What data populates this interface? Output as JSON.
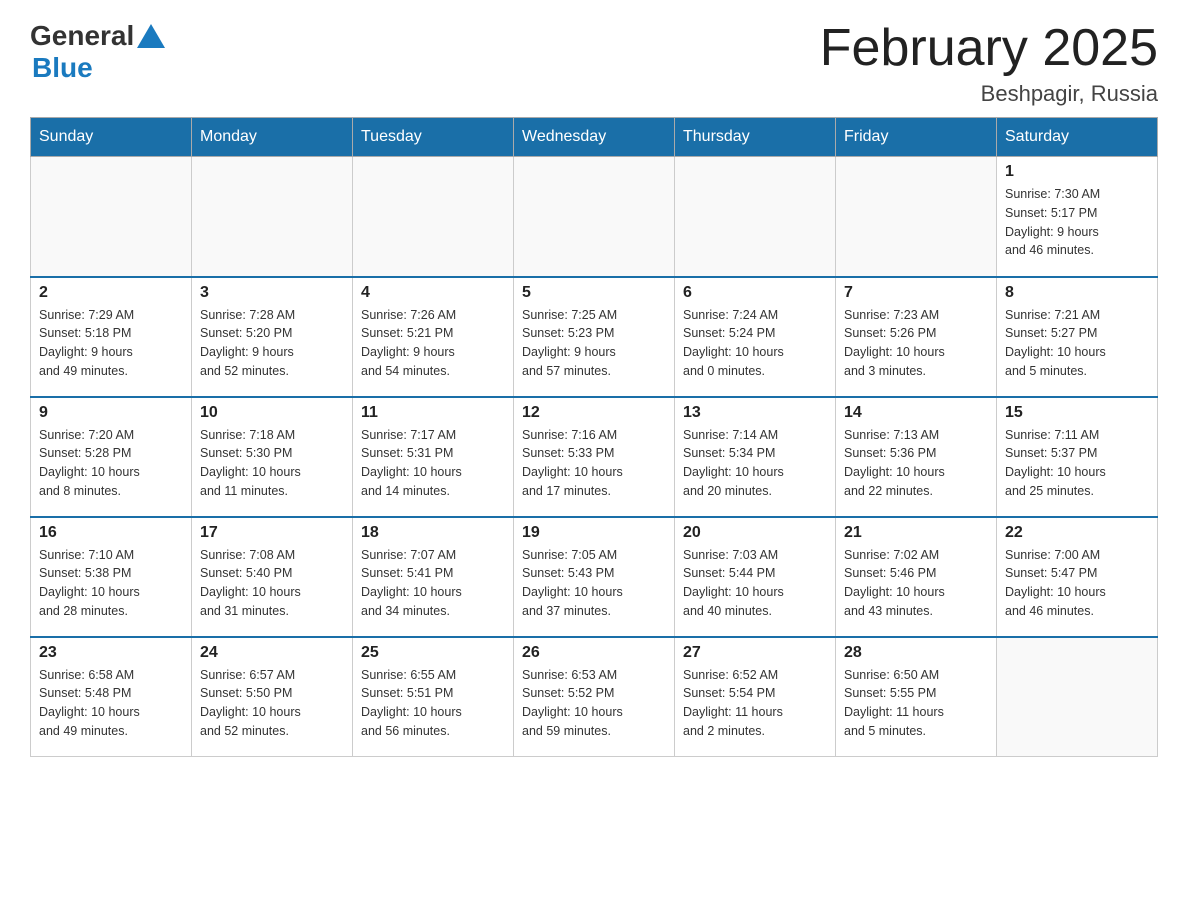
{
  "logo": {
    "general": "General",
    "blue": "Blue"
  },
  "title": "February 2025",
  "location": "Beshpagir, Russia",
  "days_of_week": [
    "Sunday",
    "Monday",
    "Tuesday",
    "Wednesday",
    "Thursday",
    "Friday",
    "Saturday"
  ],
  "weeks": [
    [
      {
        "day": "",
        "info": ""
      },
      {
        "day": "",
        "info": ""
      },
      {
        "day": "",
        "info": ""
      },
      {
        "day": "",
        "info": ""
      },
      {
        "day": "",
        "info": ""
      },
      {
        "day": "",
        "info": ""
      },
      {
        "day": "1",
        "info": "Sunrise: 7:30 AM\nSunset: 5:17 PM\nDaylight: 9 hours\nand 46 minutes."
      }
    ],
    [
      {
        "day": "2",
        "info": "Sunrise: 7:29 AM\nSunset: 5:18 PM\nDaylight: 9 hours\nand 49 minutes."
      },
      {
        "day": "3",
        "info": "Sunrise: 7:28 AM\nSunset: 5:20 PM\nDaylight: 9 hours\nand 52 minutes."
      },
      {
        "day": "4",
        "info": "Sunrise: 7:26 AM\nSunset: 5:21 PM\nDaylight: 9 hours\nand 54 minutes."
      },
      {
        "day": "5",
        "info": "Sunrise: 7:25 AM\nSunset: 5:23 PM\nDaylight: 9 hours\nand 57 minutes."
      },
      {
        "day": "6",
        "info": "Sunrise: 7:24 AM\nSunset: 5:24 PM\nDaylight: 10 hours\nand 0 minutes."
      },
      {
        "day": "7",
        "info": "Sunrise: 7:23 AM\nSunset: 5:26 PM\nDaylight: 10 hours\nand 3 minutes."
      },
      {
        "day": "8",
        "info": "Sunrise: 7:21 AM\nSunset: 5:27 PM\nDaylight: 10 hours\nand 5 minutes."
      }
    ],
    [
      {
        "day": "9",
        "info": "Sunrise: 7:20 AM\nSunset: 5:28 PM\nDaylight: 10 hours\nand 8 minutes."
      },
      {
        "day": "10",
        "info": "Sunrise: 7:18 AM\nSunset: 5:30 PM\nDaylight: 10 hours\nand 11 minutes."
      },
      {
        "day": "11",
        "info": "Sunrise: 7:17 AM\nSunset: 5:31 PM\nDaylight: 10 hours\nand 14 minutes."
      },
      {
        "day": "12",
        "info": "Sunrise: 7:16 AM\nSunset: 5:33 PM\nDaylight: 10 hours\nand 17 minutes."
      },
      {
        "day": "13",
        "info": "Sunrise: 7:14 AM\nSunset: 5:34 PM\nDaylight: 10 hours\nand 20 minutes."
      },
      {
        "day": "14",
        "info": "Sunrise: 7:13 AM\nSunset: 5:36 PM\nDaylight: 10 hours\nand 22 minutes."
      },
      {
        "day": "15",
        "info": "Sunrise: 7:11 AM\nSunset: 5:37 PM\nDaylight: 10 hours\nand 25 minutes."
      }
    ],
    [
      {
        "day": "16",
        "info": "Sunrise: 7:10 AM\nSunset: 5:38 PM\nDaylight: 10 hours\nand 28 minutes."
      },
      {
        "day": "17",
        "info": "Sunrise: 7:08 AM\nSunset: 5:40 PM\nDaylight: 10 hours\nand 31 minutes."
      },
      {
        "day": "18",
        "info": "Sunrise: 7:07 AM\nSunset: 5:41 PM\nDaylight: 10 hours\nand 34 minutes."
      },
      {
        "day": "19",
        "info": "Sunrise: 7:05 AM\nSunset: 5:43 PM\nDaylight: 10 hours\nand 37 minutes."
      },
      {
        "day": "20",
        "info": "Sunrise: 7:03 AM\nSunset: 5:44 PM\nDaylight: 10 hours\nand 40 minutes."
      },
      {
        "day": "21",
        "info": "Sunrise: 7:02 AM\nSunset: 5:46 PM\nDaylight: 10 hours\nand 43 minutes."
      },
      {
        "day": "22",
        "info": "Sunrise: 7:00 AM\nSunset: 5:47 PM\nDaylight: 10 hours\nand 46 minutes."
      }
    ],
    [
      {
        "day": "23",
        "info": "Sunrise: 6:58 AM\nSunset: 5:48 PM\nDaylight: 10 hours\nand 49 minutes."
      },
      {
        "day": "24",
        "info": "Sunrise: 6:57 AM\nSunset: 5:50 PM\nDaylight: 10 hours\nand 52 minutes."
      },
      {
        "day": "25",
        "info": "Sunrise: 6:55 AM\nSunset: 5:51 PM\nDaylight: 10 hours\nand 56 minutes."
      },
      {
        "day": "26",
        "info": "Sunrise: 6:53 AM\nSunset: 5:52 PM\nDaylight: 10 hours\nand 59 minutes."
      },
      {
        "day": "27",
        "info": "Sunrise: 6:52 AM\nSunset: 5:54 PM\nDaylight: 11 hours\nand 2 minutes."
      },
      {
        "day": "28",
        "info": "Sunrise: 6:50 AM\nSunset: 5:55 PM\nDaylight: 11 hours\nand 5 minutes."
      },
      {
        "day": "",
        "info": ""
      }
    ]
  ]
}
